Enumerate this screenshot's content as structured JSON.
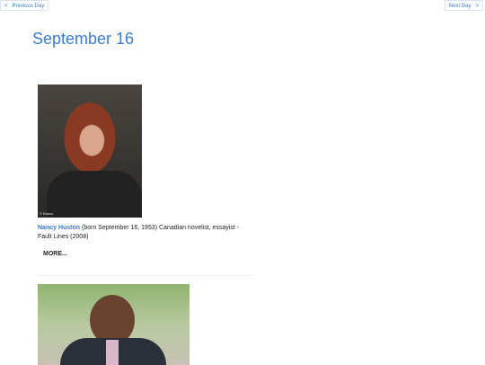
{
  "nav": {
    "prev_label": "Previous Day",
    "next_label": "Next Day",
    "prev_arrow": "<",
    "next_arrow": ">"
  },
  "page_title": "September 16",
  "entries": [
    {
      "name": "Nancy Huston",
      "description": "(born September 16, 1953) Canadian novelist, essayist - Fault Lines (2008)",
      "photo_credit": "© Basso",
      "more_label": "MORE..."
    },
    {
      "name": "",
      "description": ""
    }
  ],
  "colors": {
    "accent": "#3a7bd5",
    "text": "#222222"
  }
}
